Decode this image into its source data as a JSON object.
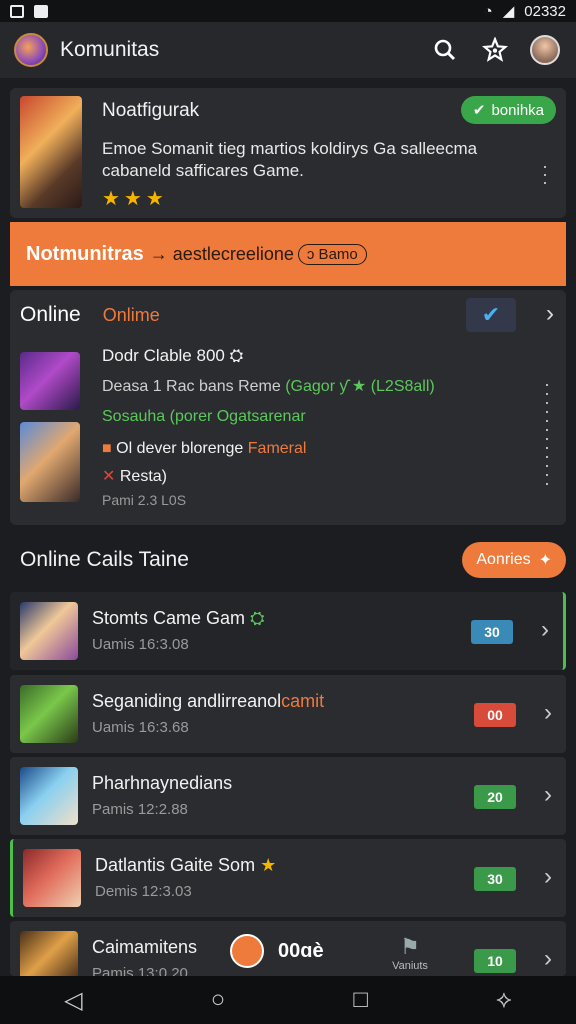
{
  "status": {
    "time": "02332"
  },
  "appbar": {
    "title": "Komunitas"
  },
  "featured": {
    "title": "Noatfigurak",
    "badge": "bonihka",
    "description": "Emoe Somanit tieg martios koldirys Ga salleecma cabaneld safficares Game.",
    "stars": "★★★"
  },
  "banner": {
    "bold": "Notmunitras",
    "text": "→ aestlecreelione",
    "pill": "ɔ Bamo"
  },
  "online_card": {
    "tab_active": "Online",
    "tab_other": "Onlime",
    "entry_title": "Dodr Clable 800 ⛭",
    "entry_line1_a": "Deasa 1 Rac bans Reme",
    "entry_line1_b": "(Gagor ƴ ★ (L2S8all)",
    "entry_line2": "Sosauha (porer Ogatsarenar",
    "entry_line3_a": "Ol dever blorenge",
    "entry_line3_b": "Fameral",
    "entry_line4": "Resta)",
    "entry_line5": "Pami 2.3 L0S"
  },
  "section": {
    "title": "Online Cails Taine",
    "action": "Aonries"
  },
  "list": [
    {
      "title": "Stomts Came Gam",
      "extra": "⛭",
      "sub": "Uamis 16:3.08",
      "badge": "30",
      "badge_color": "#3a8ab8"
    },
    {
      "title": "Seganiding andlirreanol",
      "extra": "camit",
      "sub": "Uamis 16:3.68",
      "badge": "00",
      "badge_color": "#d84a3a"
    },
    {
      "title": "Pharhnaynedians",
      "extra": "",
      "sub": "Pamis 12:2.88",
      "badge": "20",
      "badge_color": "#3a9a4a"
    },
    {
      "title": "Datlantis Gaite Som",
      "extra": "★",
      "sub": "Demis 12:3.03",
      "badge": "30",
      "badge_color": "#3a9a4a"
    },
    {
      "title": "Caimamitens",
      "extra": "",
      "sub": "Pamis 13:0.20",
      "badge": "10",
      "badge_color": "#3a9a4a"
    }
  ],
  "floating": {
    "value": "00ɑè",
    "flag_label": "Vaniuts"
  }
}
